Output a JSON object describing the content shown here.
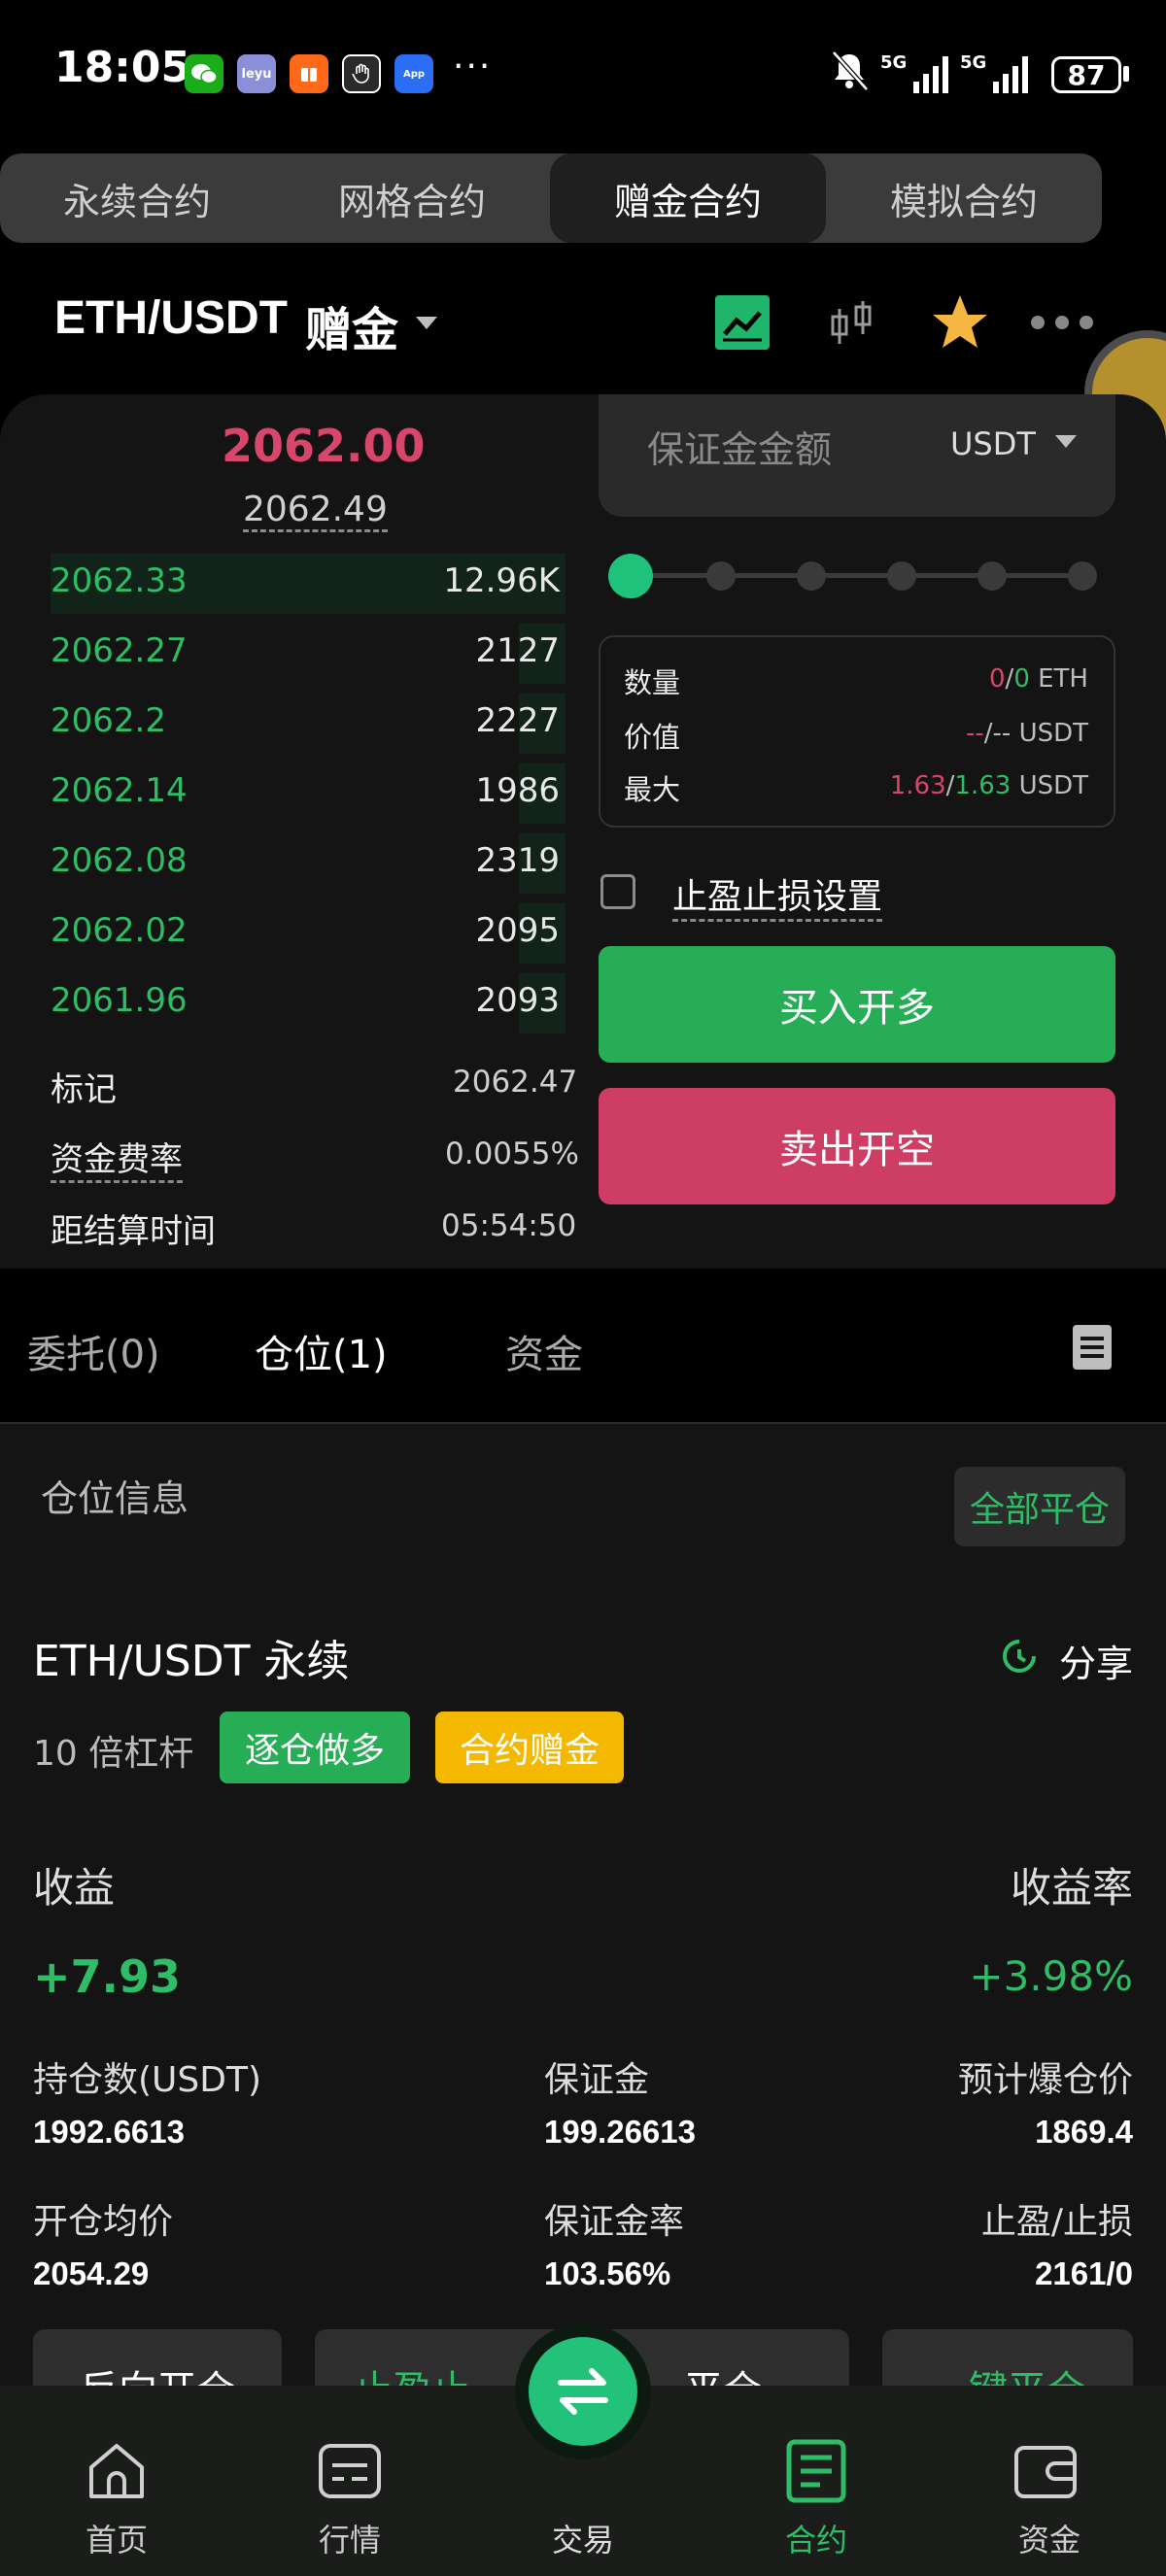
{
  "status_bar": {
    "time": "18:05",
    "more_dots": "···",
    "battery": "87",
    "net1": "5G",
    "net2": "5G"
  },
  "top_tabs": [
    {
      "label": "永续合约"
    },
    {
      "label": "网格合约"
    },
    {
      "label": "赠金合约"
    },
    {
      "label": "模拟合约"
    }
  ],
  "header": {
    "pair": "ETH/USDT",
    "tag": "赠金"
  },
  "price": {
    "last": "2062.00",
    "index": "2062.49"
  },
  "orderbook": [
    {
      "price": "2062.33",
      "qty": "12.96K",
      "depth": 0.53
    },
    {
      "price": "2062.27",
      "qty": "2127",
      "depth": 0.09
    },
    {
      "price": "2062.2",
      "qty": "2227",
      "depth": 0.09
    },
    {
      "price": "2062.14",
      "qty": "1986",
      "depth": 0.09
    },
    {
      "price": "2062.08",
      "qty": "2319",
      "depth": 0.09
    },
    {
      "price": "2062.02",
      "qty": "2095",
      "depth": 0.09
    },
    {
      "price": "2061.96",
      "qty": "2093",
      "depth": 0.09
    }
  ],
  "market_info": {
    "mark_label": "标记",
    "mark_value": "2062.47",
    "funding_label": "资金费率",
    "funding_value": "0.0055%",
    "settle_label": "距结算时间",
    "settle_value": "05:54:50"
  },
  "order_form": {
    "margin_placeholder": "保证金金额",
    "margin_unit": "USDT",
    "qty_label": "数量",
    "qty_a": "0",
    "qty_sep": "/",
    "qty_b": "0",
    "qty_unit": "ETH",
    "value_label": "价值",
    "value_a": "--",
    "value_sep": "/--",
    "value_unit": "USDT",
    "max_label": "最大",
    "max_a": "1.63",
    "max_sep": "/",
    "max_b": "1.63",
    "max_unit": "USDT",
    "tpsl_label": "止盈止损设置",
    "buy_label": "买入开多",
    "sell_label": "卖出开空"
  },
  "sub_tabs": {
    "orders": "委托(0)",
    "positions": "仓位(1)",
    "assets": "资金"
  },
  "position_section": {
    "title": "仓位信息",
    "close_all": "全部平仓"
  },
  "position": {
    "symbol": "ETH/USDT 永续",
    "share": "分享",
    "leverage": "10 倍杠杆",
    "badge_mode": "逐仓做多",
    "badge_bonus": "合约赠金",
    "pnl_label": "收益",
    "pnl_rate_label": "收益率",
    "pnl": "+7.93",
    "pnl_rate": "+3.98%",
    "size_label": "持仓数(USDT)",
    "size": "1992.6613",
    "margin_label": "保证金",
    "margin": "199.26613",
    "liq_label": "预计爆仓价",
    "liq": "1869.4",
    "entry_label": "开仓均价",
    "entry": "2054.29",
    "margin_rate_label": "保证金率",
    "margin_rate": "103.56%",
    "tpsl_label": "止盈/止损",
    "tpsl": "2161/0",
    "btn_reverse": "反向开仓",
    "btn_tpsl": "止盈止",
    "btn_close": "平仓",
    "btn_oneclick": "一键平仓"
  },
  "bottom_nav": [
    {
      "label": "首页"
    },
    {
      "label": "行情"
    },
    {
      "label": "交易"
    },
    {
      "label": "合约"
    },
    {
      "label": "资金"
    }
  ],
  "colors": {
    "green": "#2ebd66",
    "red": "#d9466b",
    "accent": "#22c27a",
    "yellow": "#f5b800"
  }
}
